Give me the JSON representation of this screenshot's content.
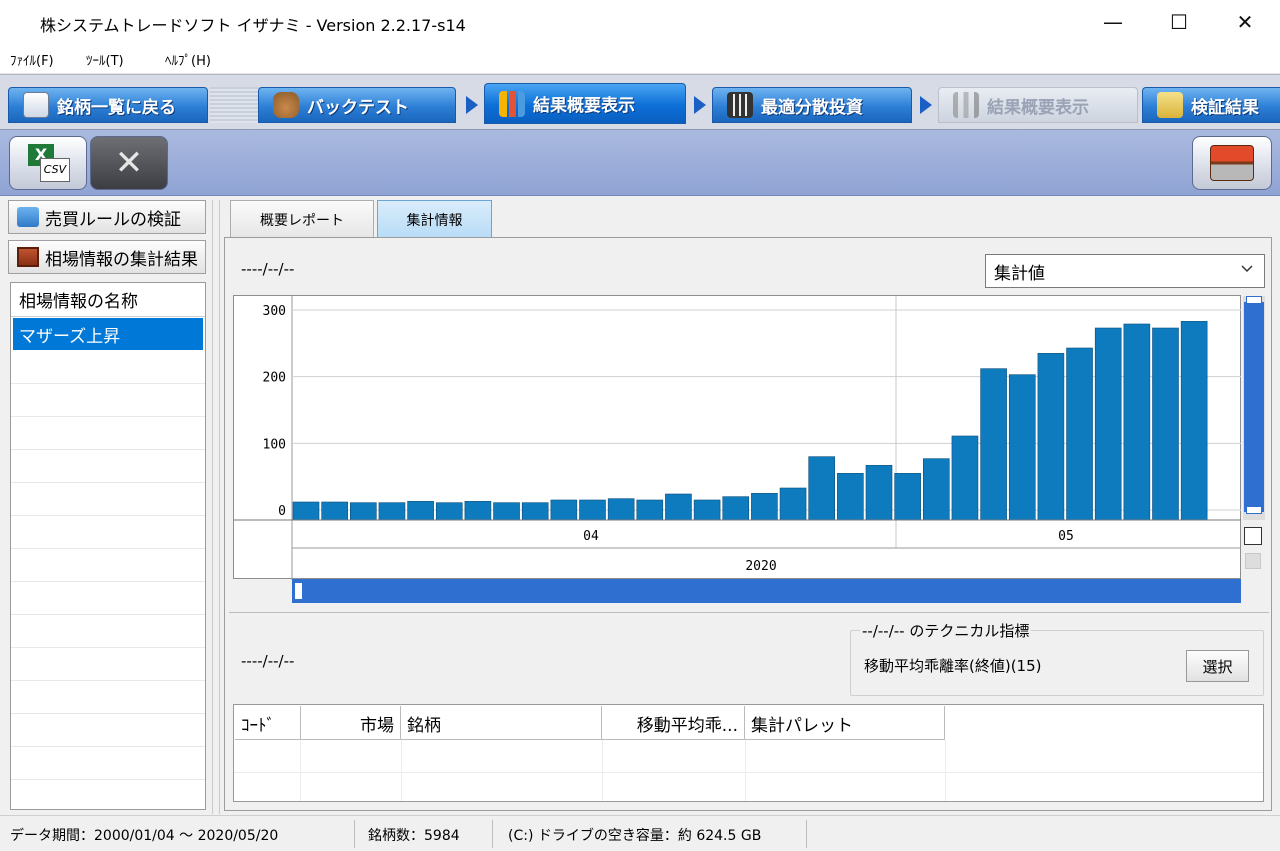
{
  "window": {
    "title": "株システムトレードソフト イザナミ - Version 2.2.17-s14",
    "controls": {
      "minimize": "—",
      "maximize": "☐",
      "close": "✕"
    }
  },
  "menu": [
    {
      "label": "ﾌｧｲﾙ(F)"
    },
    {
      "label": "ﾂｰﾙ(T)"
    },
    {
      "label": "ﾍﾙﾌﾟ(H)"
    }
  ],
  "wizard_tabs": [
    {
      "label": "銘柄一覧に戻る",
      "state": "normal",
      "icon": "eye-icon"
    },
    {
      "label": "バックテスト",
      "state": "normal",
      "icon": "bag-icon"
    },
    {
      "label": "結果概要表示",
      "state": "active",
      "icon": "chart-icon"
    },
    {
      "label": "最適分散投資",
      "state": "normal",
      "icon": "calculator-icon"
    },
    {
      "label": "結果概要表示",
      "state": "disabled",
      "icon": "chart-icon"
    },
    {
      "label": "検証結果",
      "state": "normal",
      "icon": "folder-icon"
    }
  ],
  "toolbar": {
    "csv_label": "CSV",
    "excel_letter": "X"
  },
  "left_panel": {
    "buttons": [
      {
        "label": "売買ルールの検証"
      },
      {
        "label": "相場情報の集計結果"
      }
    ],
    "list_header": "相場情報の名称",
    "items": [
      "マザーズ上昇"
    ]
  },
  "content_tabs": [
    {
      "label": "概要レポート",
      "active": false
    },
    {
      "label": "集計情報",
      "active": true
    }
  ],
  "upper": {
    "date_label": "----/--/--",
    "dropdown_value": "集計値"
  },
  "chart_data": {
    "type": "bar",
    "ylim": [
      0,
      300
    ],
    "yticks": [
      0,
      100,
      200,
      300
    ],
    "values": [
      12,
      12,
      11,
      11,
      13,
      11,
      13,
      11,
      11,
      15,
      15,
      17,
      15,
      24,
      15,
      20,
      25,
      33,
      80,
      55,
      67,
      55,
      77,
      111,
      212,
      203,
      235,
      243,
      273,
      279,
      273,
      283
    ],
    "x_month_labels": [
      "04",
      "05"
    ],
    "x_year_label": "2020",
    "bar_color": "#0f7bbf"
  },
  "lower": {
    "date_label": "----/--/--",
    "tech_title": "--/--/-- のテクニカル指標",
    "tech_value": "移動平均乖離率(終値)(15)",
    "select_button": "選択"
  },
  "table": {
    "columns": [
      "ｺｰﾄﾞ",
      "市場",
      "銘柄",
      "移動平均乖...",
      "集計パレット"
    ]
  },
  "status": {
    "period": "データ期間：2000/01/04 ～ 2020/05/20",
    "count": "銘柄数：5984",
    "drive": "(C:) ドライブの空き容量：約 624.5 GB"
  }
}
